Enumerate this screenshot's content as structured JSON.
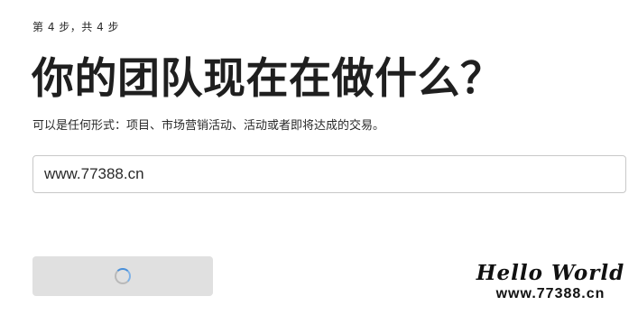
{
  "header": {
    "step_label": "第 4 步，共 4 步",
    "title": "你的团队现在在做什么？",
    "subtitle": "可以是任何形式：项目、市场营销活动、活动或者即将达成的交易。"
  },
  "form": {
    "team_activity_value": "www.77388.cn"
  },
  "actions": {
    "next_button_state": "loading"
  },
  "watermark": {
    "logo_text": "Hello World",
    "url_text": "www.77388.cn"
  },
  "colors": {
    "button_background": "#e0e0e0",
    "spinner_accent": "#4a90d9",
    "input_border": "#c8c8c8"
  }
}
